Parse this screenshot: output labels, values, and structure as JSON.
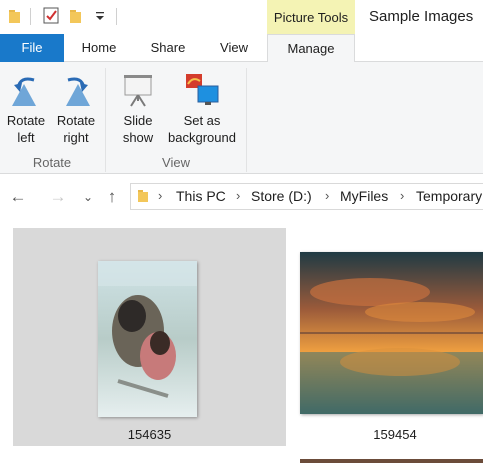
{
  "window": {
    "title": "Sample Images",
    "contextual_group_label": "Picture Tools"
  },
  "quick_access": {
    "icons": [
      "folder-icon",
      "properties-checkmark-icon",
      "new-folder-icon",
      "customize-dropdown-icon"
    ]
  },
  "tabs": [
    "File",
    "Home",
    "Share",
    "View",
    "Manage"
  ],
  "ribbon": {
    "groups": [
      {
        "label": "Rotate",
        "buttons": [
          {
            "label_line1": "Rotate",
            "label_line2": "left",
            "icon": "rotate-left-icon"
          },
          {
            "label_line1": "Rotate",
            "label_line2": "right",
            "icon": "rotate-right-icon"
          }
        ]
      },
      {
        "label": "View",
        "buttons": [
          {
            "label_line1": "Slide",
            "label_line2": "show",
            "icon": "slide-show-icon"
          },
          {
            "label_line1": "Set as",
            "label_line2": "background",
            "icon": "set-background-icon"
          }
        ]
      }
    ]
  },
  "address_bar": {
    "crumbs": [
      "This PC",
      "Store (D:)",
      "MyFiles",
      "Temporary"
    ]
  },
  "files": [
    {
      "name": "154635",
      "selected": true
    },
    {
      "name": "159454",
      "selected": false
    }
  ],
  "colors": {
    "file_tab": "#1979ca",
    "contextual_tab": "#f4f3b4",
    "selection": "#d9d9d9",
    "ribbon_bg": "#f5f6f7"
  }
}
